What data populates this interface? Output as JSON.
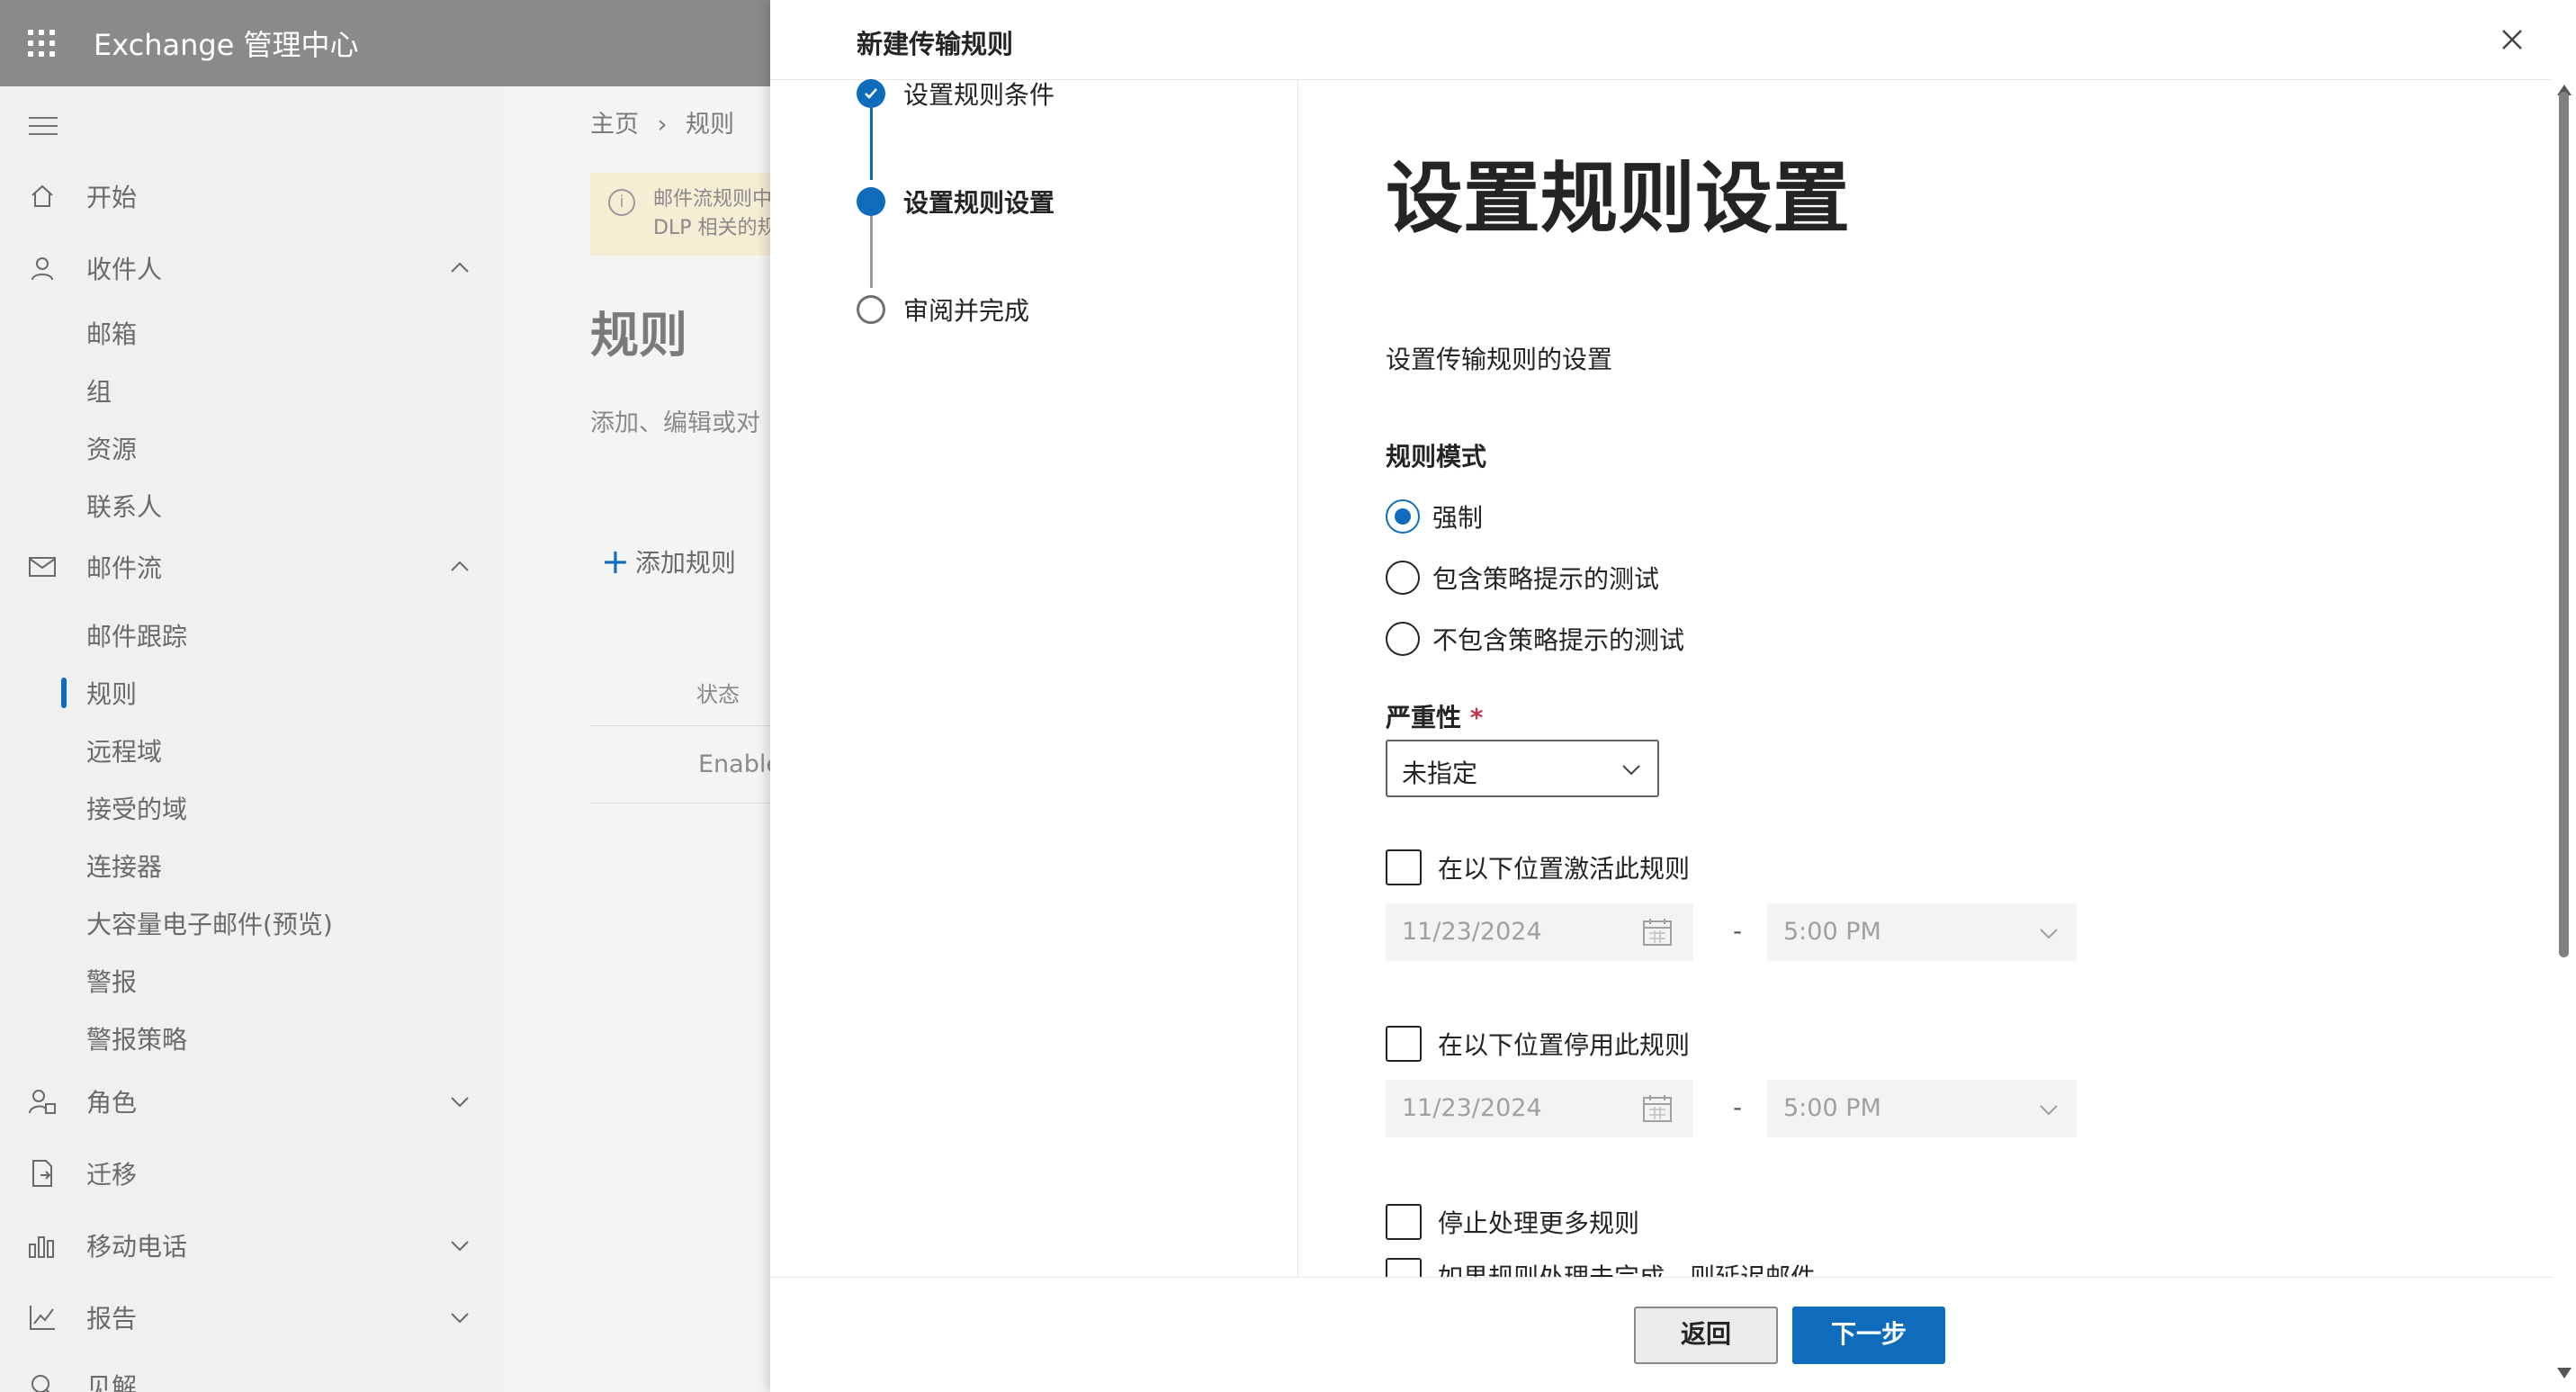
{
  "app": {
    "title": "Exchange 管理中心"
  },
  "nav": {
    "items": [
      {
        "label": "开始",
        "icon": "home-icon"
      },
      {
        "label": "收件人",
        "icon": "person-icon",
        "expanded": true
      },
      {
        "label": "邮件流",
        "icon": "mail-icon",
        "expanded": true
      },
      {
        "label": "角色",
        "icon": "role-icon",
        "expanded": false
      },
      {
        "label": "迁移",
        "icon": "migration-icon"
      },
      {
        "label": "移动电话",
        "icon": "mobile-icon",
        "expanded": false
      },
      {
        "label": "报告",
        "icon": "chart-icon",
        "expanded": false
      },
      {
        "label": "见解",
        "icon": "insights-icon"
      }
    ],
    "recipients_sub": [
      "邮箱",
      "组",
      "资源",
      "联系人"
    ],
    "mailflow_sub": [
      "邮件跟踪",
      "规则",
      "远程域",
      "接受的域",
      "连接器",
      "大容量电子邮件(预览)",
      "警报",
      "警报策略"
    ],
    "active_sub": "规则"
  },
  "background_page": {
    "breadcrumb": [
      "主页",
      "规则"
    ],
    "info_line1": "邮件流规则中",
    "info_line2": "DLP 相关的规",
    "title": "规则",
    "description": "添加、编辑或对",
    "add_rule": "添加规则",
    "column_status": "状态",
    "row_status": "Enable"
  },
  "panel": {
    "title": "新建传输规则",
    "steps": [
      {
        "label": "设置规则条件",
        "state": "completed"
      },
      {
        "label": "设置规则设置",
        "state": "current"
      },
      {
        "label": "审阅并完成",
        "state": "pending"
      }
    ],
    "heading": "设置规则设置",
    "subheading": "设置传输规则的设置",
    "rule_mode": {
      "label": "规则模式",
      "options": [
        "强制",
        "包含策略提示的测试",
        "不包含策略提示的测试"
      ],
      "selected": "强制"
    },
    "severity": {
      "label": "严重性",
      "required_marker": "*",
      "value": "未指定"
    },
    "activate": {
      "label": "在以下位置激活此规则",
      "checked": false,
      "date": "11/23/2024",
      "time": "5:00 PM"
    },
    "deactivate": {
      "label": "在以下位置停用此规则",
      "checked": false,
      "date": "11/23/2024",
      "time": "5:00 PM"
    },
    "date_time_separator": "-",
    "stop_processing": {
      "label": "停止处理更多规则",
      "checked": false
    },
    "defer": {
      "label": "如果规则处理未完成，则延迟邮件",
      "checked": false
    },
    "buttons": {
      "back": "返回",
      "next": "下一步"
    }
  },
  "colors": {
    "accent": "#0f6cbd",
    "topbar": "#8a8a8a",
    "info_bg": "#f6edd5",
    "required": "#c4314b"
  }
}
